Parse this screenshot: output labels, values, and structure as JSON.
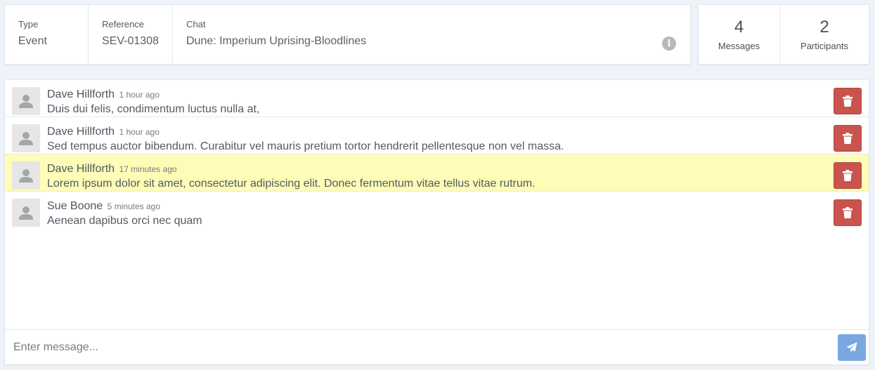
{
  "info": {
    "type_label": "Type",
    "type_value": "Event",
    "reference_label": "Reference",
    "reference_value": "SEV-01308",
    "chat_label": "Chat",
    "chat_value": "Dune: Imperium Uprising-Bloodlines",
    "info_icon": "info-icon"
  },
  "stats": {
    "messages_count": "4",
    "messages_label": "Messages",
    "participants_count": "2",
    "participants_label": "Participants"
  },
  "messages": [
    {
      "author": "Dave Hillforth",
      "time": "1 hour ago",
      "text": "Duis dui felis, condimentum luctus nulla at,",
      "highlighted": false
    },
    {
      "author": "Dave Hillforth",
      "time": "1 hour ago",
      "text": "Sed tempus auctor bibendum. Curabitur vel mauris pretium tortor hendrerit pellentesque non vel massa.",
      "highlighted": false
    },
    {
      "author": "Dave Hillforth",
      "time": "17 minutes ago",
      "text": "Lorem ipsum dolor sit amet, consectetur adipiscing elit. Donec fermentum vitae tellus vitae rutrum.",
      "highlighted": true
    },
    {
      "author": "Sue Boone",
      "time": "5 minutes ago",
      "text": "Aenean dapibus orci nec quam",
      "highlighted": false
    }
  ],
  "composer": {
    "placeholder": "Enter message...",
    "send_icon": "paper-plane-icon"
  },
  "icons": {
    "avatar": "user-icon",
    "delete": "trash-icon"
  },
  "colors": {
    "delete_button": "#c9534f",
    "send_button": "#7aa7e0",
    "highlight_row": "#fefcb7",
    "page_background": "#eef3fa"
  }
}
